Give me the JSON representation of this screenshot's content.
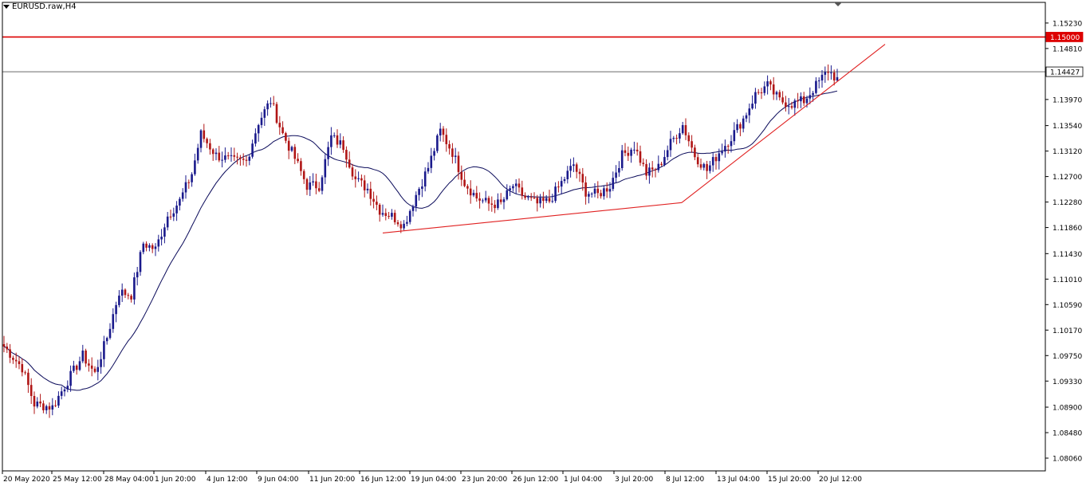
{
  "symbol_title": "EURUSD.raw,H4",
  "colors": {
    "background": "#ffffff",
    "bull": "#1a1a8c",
    "bear": "#b01515",
    "ma": "#0a0a5a",
    "resistance": "#dd0000",
    "trendline": "#e02020",
    "bid_line": "#555555"
  },
  "price_labels": {
    "resistance": "1.15000",
    "bid": "1.14427"
  },
  "chart_data": {
    "type": "candlestick",
    "title": "EURUSD.raw,H4",
    "ylim": [
      1.0785,
      1.1557
    ],
    "y_ticks": [
      "1.15230",
      "1.14810",
      "1.13970",
      "1.13540",
      "1.13120",
      "1.12700",
      "1.12280",
      "1.11860",
      "1.11430",
      "1.11010",
      "1.10590",
      "1.10170",
      "1.09750",
      "1.09330",
      "1.08900",
      "1.08480",
      "1.08060"
    ],
    "x_ticks": [
      "20 May 2020",
      "25 May 12:00",
      "28 May 04:00",
      "1 Jun 20:00",
      "4 Jun 12:00",
      "9 Jun 04:00",
      "11 Jun 20:00",
      "16 Jun 12:00",
      "19 Jun 04:00",
      "23 Jun 20:00",
      "26 Jun 12:00",
      "1 Jul 04:00",
      "3 Jul 20:00",
      "8 Jul 12:00",
      "13 Jul 04:00",
      "15 Jul 20:00",
      "20 Jul 12:00"
    ],
    "close_anchors": [
      [
        0,
        1.099
      ],
      [
        6,
        1.0955
      ],
      [
        10,
        1.0895
      ],
      [
        16,
        1.089
      ],
      [
        20,
        1.0925
      ],
      [
        26,
        1.0975
      ],
      [
        30,
        1.0945
      ],
      [
        34,
        1.1005
      ],
      [
        38,
        1.108
      ],
      [
        42,
        1.1075
      ],
      [
        46,
        1.116
      ],
      [
        50,
        1.115
      ],
      [
        54,
        1.1205
      ],
      [
        58,
        1.123
      ],
      [
        62,
        1.1275
      ],
      [
        65,
        1.134
      ],
      [
        70,
        1.1305
      ],
      [
        76,
        1.1295
      ],
      [
        80,
        1.1295
      ],
      [
        84,
        1.136
      ],
      [
        88,
        1.1395
      ],
      [
        92,
        1.134
      ],
      [
        96,
        1.13
      ],
      [
        100,
        1.1255
      ],
      [
        104,
        1.1255
      ],
      [
        108,
        1.1335
      ],
      [
        112,
        1.132
      ],
      [
        116,
        1.1265
      ],
      [
        120,
        1.125
      ],
      [
        124,
        1.1215
      ],
      [
        128,
        1.1205
      ],
      [
        132,
        1.119
      ],
      [
        136,
        1.124
      ],
      [
        140,
        1.1285
      ],
      [
        144,
        1.1345
      ],
      [
        148,
        1.131
      ],
      [
        152,
        1.126
      ],
      [
        156,
        1.1235
      ],
      [
        160,
        1.1225
      ],
      [
        164,
        1.1225
      ],
      [
        168,
        1.1255
      ],
      [
        172,
        1.1235
      ],
      [
        176,
        1.1225
      ],
      [
        180,
        1.123
      ],
      [
        184,
        1.126
      ],
      [
        188,
        1.129
      ],
      [
        192,
        1.1245
      ],
      [
        196,
        1.124
      ],
      [
        200,
        1.1255
      ],
      [
        204,
        1.1305
      ],
      [
        208,
        1.132
      ],
      [
        212,
        1.1275
      ],
      [
        216,
        1.1285
      ],
      [
        220,
        1.1325
      ],
      [
        224,
        1.1355
      ],
      [
        228,
        1.1305
      ],
      [
        232,
        1.128
      ],
      [
        236,
        1.131
      ],
      [
        240,
        1.1335
      ],
      [
        244,
        1.1365
      ],
      [
        248,
        1.1405
      ],
      [
        252,
        1.142
      ],
      [
        256,
        1.1395
      ],
      [
        260,
        1.139
      ],
      [
        264,
        1.1395
      ],
      [
        268,
        1.142
      ],
      [
        272,
        1.1445
      ],
      [
        275,
        1.143
      ]
    ],
    "moving_average": "smooth line following closes",
    "horizontal_line": 1.15,
    "bid_line": 1.14427,
    "trendlines": [
      {
        "from": [
          "16 Jun 12:00+",
          1.1177
        ],
        "to": [
          "8 Jul 12:00",
          1.1227
        ]
      },
      {
        "from": [
          "8 Jul 12:00",
          1.1227
        ],
        "to": [
          "22 Jul",
          1.1488
        ]
      }
    ]
  }
}
